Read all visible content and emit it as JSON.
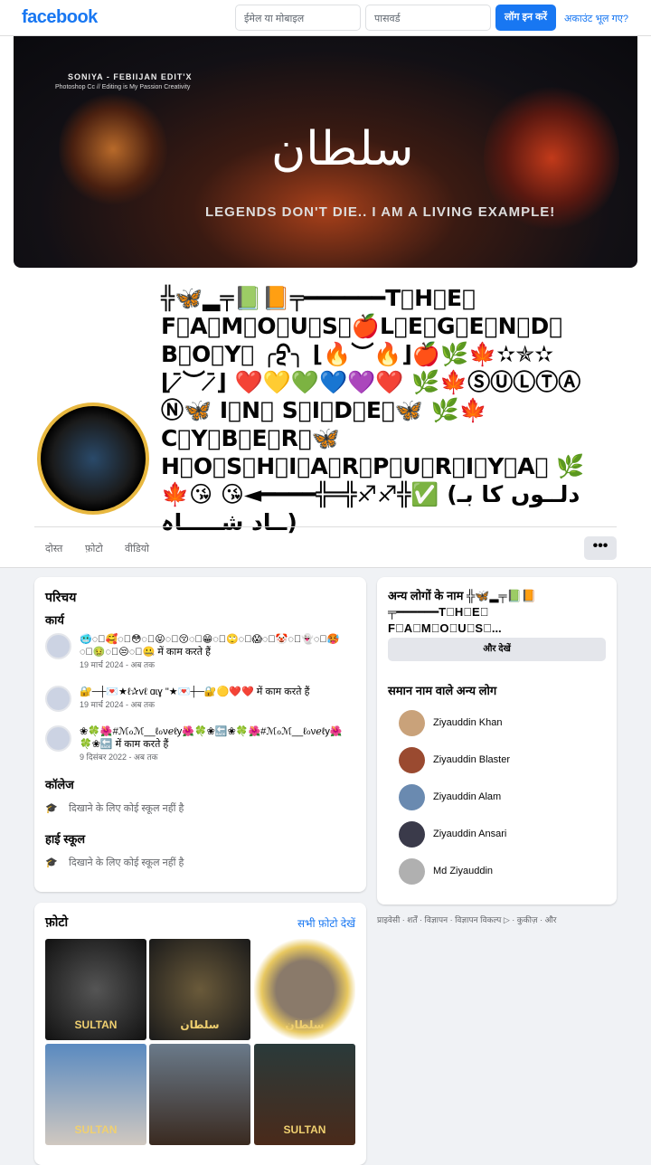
{
  "header": {
    "logo": "facebook",
    "email_placeholder": "ईमेल या मोबाइल",
    "password_placeholder": "पासवर्ड",
    "login": "लॉग इन करें",
    "forgot": "अकाउंट भूल गए?"
  },
  "cover": {
    "line1": "SONIYA - FEBIIJAN EDIT'X",
    "line2": "Photoshop Cc // Editing is My Passion Creativity",
    "title": "سلطان",
    "tagline": "LEGENDS DON'T DIE.. I AM A LIVING EXAMPLE!"
  },
  "profile": {
    "name": "╬🦋▂╤📗📙╤━━━━━━T⃞H⃞E⃞ F⃞A⃞M⃞O⃞U⃞S⃞🍎L⃞E⃞G⃞E⃞N⃞D⃞ B⃞O⃞Y⃞ ╭ᢓ╮ ⌊🔥︶🔥⌋🍎🌿🍁✫✯✫⌊ˉ̷︶ˉ̷⌋ ❤️💛💚💙💜❤️ 🌿🍁ⓈⓊⓁⓉⒶⓃ🦋 I⃞N⃞ S⃞I⃞D⃞E⃞🦋 🌿🍁C⃞Y⃞B⃞E⃞R⃞🦋 H⃞O⃞S⃞H⃞I⃞A⃞R⃞P⃞U⃞R⃞I⃞Y⃞A⃞ 🌿🍁😘 😘◄━━━━╬═╬♐♐╬✅ (دلــوں کا بـــاد شـــــاہ)"
  },
  "tabs": [
    "दोस्त",
    "फ़ोटो",
    "वीडियो"
  ],
  "more_label": "•••",
  "intro": {
    "title": "परिचय",
    "work_title": "कार्य",
    "work": [
      {
        "text": "🥶◌⃘🥰◌⃘😳◌⃘😝◌⃘😚◌⃘😁◌⃘🙄◌⃘😱◌⃘🤡◌⃘👻◌⃘🥵◌⃘🤢◌⃘😒◌⃘🤐 में काम करते हैं",
        "date": "19 मार्च 2024 - अब तक"
      },
      {
        "text": "🔐─┼💌★ℓ✰vℓ ɑɩɣ \"★💌┼─🔐🟡❤️❤️ में काम करते हैं",
        "date": "19 मार्च 2024 - अब तक"
      },
      {
        "text": "❀🍀🌺#ℳℴℳ__ℓℴνℯℓy🌺🍀❀🔙❀🍀🌺#ℳℴℳ__ℓℴνℯℓy🌺🍀❀🔙 में काम करते हैं",
        "date": "9 दिसंबर 2022 - अब तक"
      }
    ],
    "college_title": "कॉलेज",
    "college": "दिखाने के लिए कोई स्कूल नहीं है",
    "hs_title": "हाई स्कूल",
    "hs": "दिखाने के लिए कोई स्कूल नहीं है"
  },
  "photos": {
    "title": "फ़ोटो",
    "see_all": "सभी फ़ोटो देखें",
    "items": [
      "SULTAN",
      "سلطان",
      "سلطان",
      "SULTAN",
      "",
      "SULTAN"
    ]
  },
  "others": {
    "title": "अन्य लोगों के नाम ╬🦋▂╤📗📙╤━━━━━━T⃞H⃞E⃞ F⃞A⃞M⃞O⃞U⃞S⃞...",
    "see_more": "और देखें",
    "similar_title": "समान नाम वाले अन्य लोग",
    "people": [
      {
        "name": "Ziyauddin Khan",
        "color": "#c9a27a"
      },
      {
        "name": "Ziyauddin Blaster",
        "color": "#9a4a30"
      },
      {
        "name": "Ziyauddin Alam",
        "color": "#6a8ab0"
      },
      {
        "name": "Ziyauddin Ansari",
        "color": "#3a3a4a"
      },
      {
        "name": "Md Ziyauddin",
        "color": "#b0b0b0"
      }
    ]
  },
  "footer": "प्राइवेसी · शर्तें · विज्ञापन · विज्ञापन विकल्प ▷ · कुकीज़ · और"
}
